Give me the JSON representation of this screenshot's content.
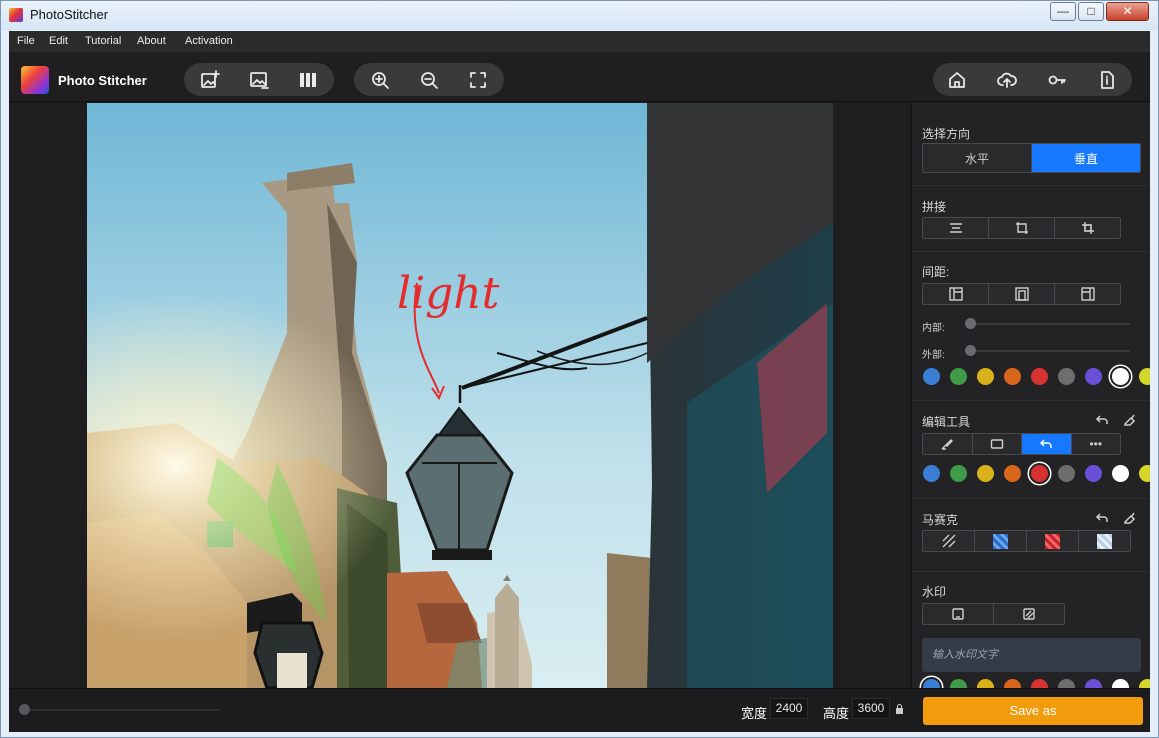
{
  "window": {
    "title": "PhotoStitcher",
    "minimize": "—",
    "maximize": "□",
    "close": "✕"
  },
  "menu": {
    "items": [
      "File",
      "Edit",
      "Tutorial",
      "About",
      "Activation"
    ]
  },
  "toolbar": {
    "brand": "Photo Stitcher"
  },
  "photo": {
    "annotation": "light"
  },
  "panel": {
    "direction": {
      "title": "选择方向",
      "options": [
        "水平",
        "垂直"
      ],
      "selected": "垂直"
    },
    "stitch": {
      "title": "拼接"
    },
    "spacing": {
      "title": "间距:",
      "inner_label": "内部:",
      "outer_label": "外部:"
    },
    "edit_tools": {
      "title": "编辑工具",
      "more": "•••"
    },
    "mosaic": {
      "title": "马赛克"
    },
    "watermark": {
      "title": "水印",
      "placeholder": "输入水印文字"
    },
    "colors": [
      "#3b7fd4",
      "#3f9b47",
      "#d9b21b",
      "#d9671b",
      "#d63232",
      "#6e6e70",
      "#6a50d6",
      "#ffffff",
      "#d6d62a"
    ]
  },
  "bottom": {
    "width_label": "宽度",
    "width_value": "2400",
    "height_label": "高度",
    "height_value": "3600",
    "save_label": "Save as",
    "zoom_level": 0.0
  }
}
